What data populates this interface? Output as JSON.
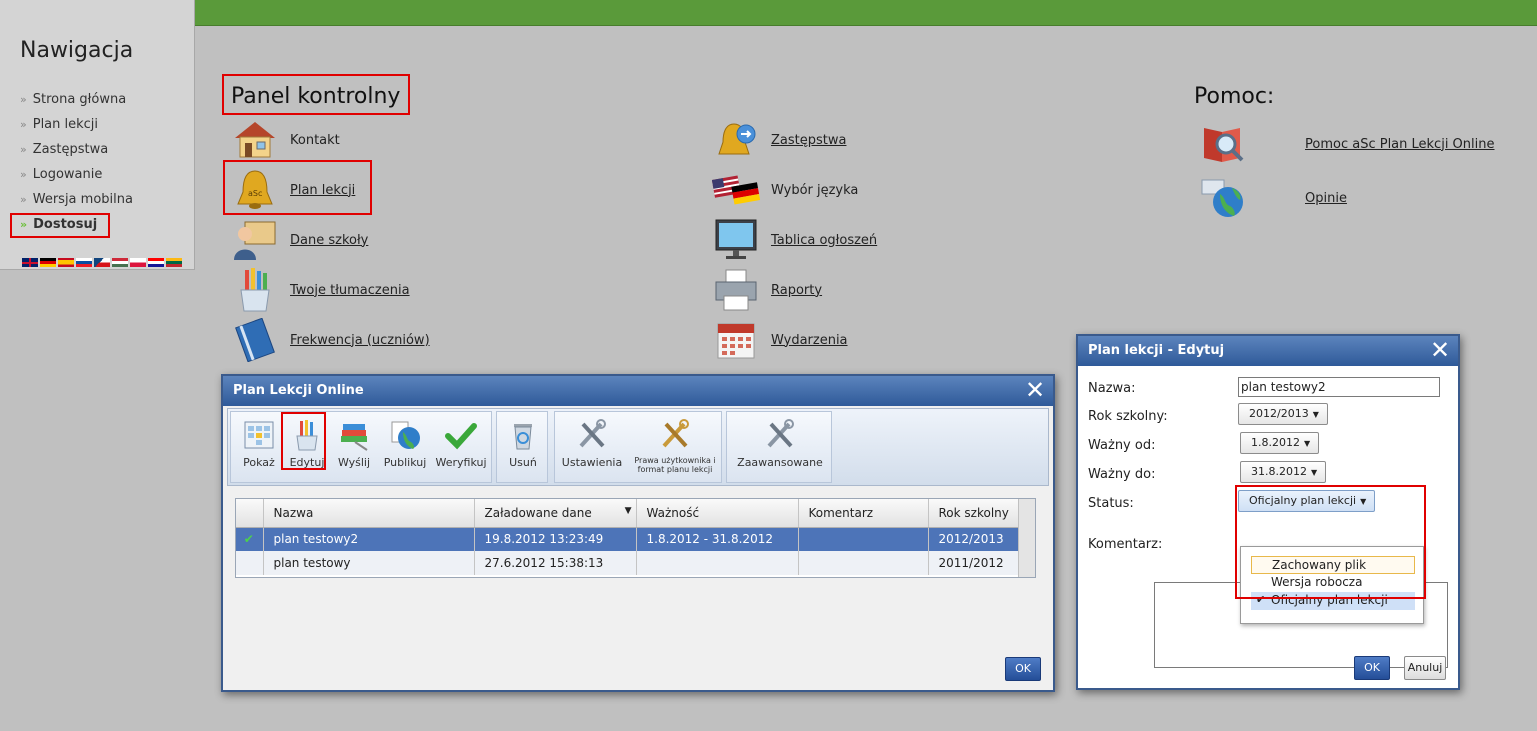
{
  "sidebar": {
    "title": "Nawigacja",
    "items": [
      {
        "label": "Strona główna"
      },
      {
        "label": "Plan lekcji"
      },
      {
        "label": "Zastępstwa"
      },
      {
        "label": "Logowanie"
      },
      {
        "label": "Wersja mobilna"
      },
      {
        "label": "Dostosuj",
        "active": true
      }
    ],
    "language_flags": [
      "english-flag",
      "german-flag",
      "spanish-flag",
      "slovak-flag",
      "czech-flag",
      "hungarian-flag",
      "polish-flag",
      "croatian-flag",
      "lithuanian-flag"
    ]
  },
  "panel": {
    "title": "Panel kontrolny",
    "col1": [
      {
        "label": "Kontakt",
        "icon": "house-icon"
      },
      {
        "label": "Plan lekcji",
        "icon": "bell-icon"
      },
      {
        "label": "Dane szkoły",
        "icon": "teacher-icon"
      },
      {
        "label": "Twoje tłumaczenia",
        "icon": "pencils-cup-icon"
      },
      {
        "label": "Frekwencja (uczniów)",
        "icon": "notebook-icon"
      }
    ],
    "col2": [
      {
        "label": "Zastępstwa",
        "icon": "bell-swap-icon"
      },
      {
        "label": "Wybór języka",
        "icon": "flags-icon"
      },
      {
        "label": "Tablica ogłoszeń",
        "icon": "monitor-icon"
      },
      {
        "label": "Raporty",
        "icon": "printer-icon"
      },
      {
        "label": "Wydarzenia",
        "icon": "calendar-icon"
      }
    ]
  },
  "help": {
    "title": "Pomoc:",
    "items": [
      {
        "label": "Pomoc aSc Plan Lekcji Online",
        "icon": "help-book-icon"
      },
      {
        "label": "Opinie",
        "icon": "globe-icon"
      }
    ]
  },
  "main_window": {
    "title": "Plan Lekcji Online",
    "toolbar": {
      "show": "Pokaż",
      "edit": "Edytuj",
      "send": "Wyślij",
      "publish": "Publikuj",
      "verify": "Weryfikuj",
      "delete": "Usuń",
      "settings": "Ustawienia",
      "user_rights": "Prawa użytkownika i format planu lekcji",
      "advanced": "Zaawansowane"
    },
    "table": {
      "columns": [
        "Nazwa",
        "Załadowane dane",
        "Ważność",
        "Komentarz",
        "Rok szkolny"
      ],
      "rows": [
        {
          "selected": true,
          "name": "plan testowy2",
          "loaded": "19.8.2012 13:23:49",
          "validity": "1.8.2012 - 31.8.2012",
          "comment": "",
          "year": "2012/2013"
        },
        {
          "selected": false,
          "name": "plan testowy",
          "loaded": "27.6.2012 15:38:13",
          "validity": "",
          "comment": "",
          "year": "2011/2012"
        }
      ]
    },
    "ok": "OK"
  },
  "edit_dialog": {
    "title": "Plan lekcji - Edytuj",
    "labels": {
      "name": "Nazwa:",
      "school_year": "Rok szkolny:",
      "valid_from": "Ważny od:",
      "valid_to": "Ważny do:",
      "status": "Status:",
      "comment": "Komentarz:"
    },
    "values": {
      "name": "plan testowy2",
      "school_year": "2012/2013",
      "valid_from": "1.8.2012",
      "valid_to": "31.8.2012",
      "status": "Oficjalny plan lekcji"
    },
    "status_options": [
      "Zachowany plik",
      "Wersja robocza",
      "Oficjalny plan lekcji"
    ],
    "ok": "OK",
    "cancel": "Anuluj"
  }
}
